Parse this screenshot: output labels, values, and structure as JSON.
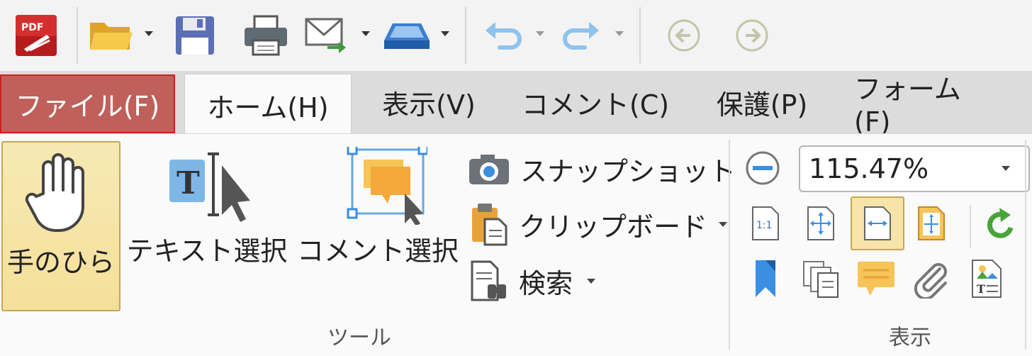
{
  "quick_access": {
    "items": [
      "app-logo",
      "open",
      "save",
      "print",
      "email",
      "scan",
      "undo",
      "redo",
      "back",
      "forward"
    ]
  },
  "app_logo_text": "PDF",
  "tabs": [
    {
      "label": "ファイル(F)"
    },
    {
      "label": "ホーム(H)"
    },
    {
      "label": "表示(V)"
    },
    {
      "label": "コメント(C)"
    },
    {
      "label": "保護(P)"
    },
    {
      "label": "フォーム(F)"
    }
  ],
  "tools": {
    "hand": "手のひら",
    "text_select": "テキスト選択",
    "comment_select": "コメント選択",
    "snapshot": "スナップショット",
    "clipboard": "クリップボード",
    "search": "検索",
    "group_label": "ツール"
  },
  "view": {
    "zoom_value": "115.47%",
    "group_label": "表示",
    "actual_size_label": "1:1"
  },
  "colors": {
    "file_tab": "#c0605a",
    "file_tab_border": "#d0201a",
    "active_button": "#f6e4a8"
  }
}
